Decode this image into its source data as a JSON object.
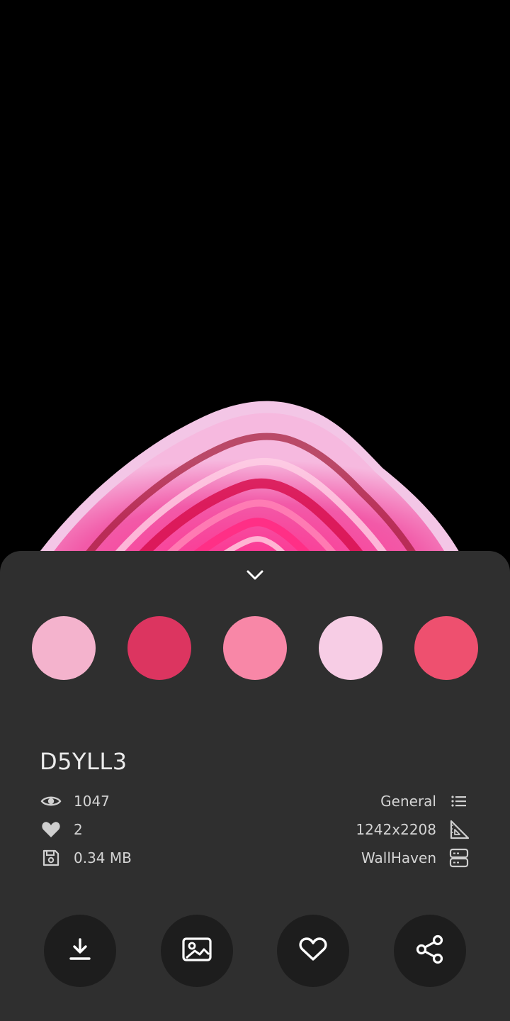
{
  "wallpaper": {
    "id": "D5YLL3",
    "background_color": "#000000"
  },
  "palette": {
    "colors": [
      "#f4b3cd",
      "#dc3560",
      "#f887a7",
      "#f7cde5",
      "#ee506f"
    ]
  },
  "stats": {
    "views": "1047",
    "favorites": "2",
    "file_size": "0.34 MB",
    "category": "General",
    "resolution": "1242x2208",
    "source": "WallHaven"
  },
  "icons": {
    "collapse": "chevron-down-icon",
    "views": "eye-icon",
    "favorites": "heart-icon",
    "size": "save-disk-icon",
    "category": "list-icon",
    "resolution": "set-square-ruler-icon",
    "source": "server-icon",
    "download": "download-icon",
    "set_wallpaper": "image-icon",
    "favorite": "heart-outline-icon",
    "share": "share-icon"
  },
  "theme": {
    "sheet_bg": "#2f2f2f",
    "button_bg": "#1d1d1d",
    "text": "#d4d4d4"
  }
}
